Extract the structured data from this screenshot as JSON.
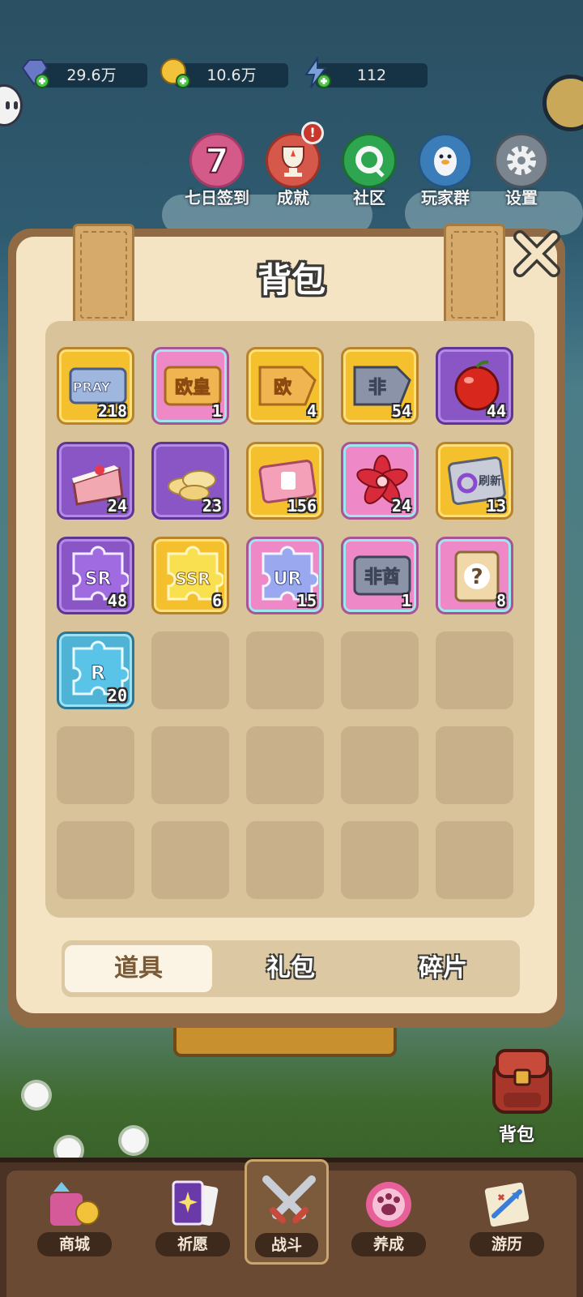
{
  "resources": [
    {
      "icon": "gem-plus-icon",
      "value": "29.6万"
    },
    {
      "icon": "coin-plus-icon",
      "value": "10.6万"
    },
    {
      "icon": "energy-plus-icon",
      "value": "112"
    }
  ],
  "menu": [
    {
      "label": "七日签到",
      "icon": "seven-day-icon",
      "badge": "7"
    },
    {
      "label": "成就",
      "icon": "trophy-icon",
      "alert": "!"
    },
    {
      "label": "社区",
      "icon": "chat-bubble-icon"
    },
    {
      "label": "玩家群",
      "icon": "penguin-icon"
    },
    {
      "label": "设置",
      "icon": "gear-icon"
    }
  ],
  "panel": {
    "title": "背包",
    "items": [
      {
        "name": "pray-ticket",
        "frame": "gold",
        "count": "218",
        "text": "PRAY"
      },
      {
        "name": "ouhuang-ticket",
        "frame": "pink",
        "count": "1",
        "text": "欧皇"
      },
      {
        "name": "ouhuang-fragment",
        "frame": "gold",
        "count": "4",
        "text": "欧"
      },
      {
        "name": "feiqiu-fragment",
        "frame": "gold",
        "count": "54",
        "text": "非"
      },
      {
        "name": "apple",
        "frame": "purple",
        "count": "44"
      },
      {
        "name": "cake",
        "frame": "purple",
        "count": "24"
      },
      {
        "name": "chips",
        "frame": "purple",
        "count": "23"
      },
      {
        "name": "gacha-ticket",
        "frame": "gold",
        "count": "156"
      },
      {
        "name": "flower-token",
        "frame": "pink",
        "count": "24"
      },
      {
        "name": "refresh-card",
        "frame": "gold",
        "count": "13",
        "text": "刷新"
      },
      {
        "name": "sr-puzzle",
        "frame": "purple",
        "count": "48",
        "text": "SR"
      },
      {
        "name": "ssr-puzzle",
        "frame": "gold",
        "count": "6",
        "text": "SSR"
      },
      {
        "name": "ur-puzzle",
        "frame": "pink",
        "count": "15",
        "text": "UR"
      },
      {
        "name": "feiqiu-ticket",
        "frame": "pink",
        "count": "1",
        "text": "非酋"
      },
      {
        "name": "mystery-pack",
        "frame": "pink",
        "count": "8",
        "text": "?"
      },
      {
        "name": "r-puzzle",
        "frame": "blue",
        "count": "20",
        "text": "R"
      }
    ],
    "empty_slots": 14,
    "tabs": [
      "道具",
      "礼包",
      "碎片"
    ],
    "active_tab": "道具"
  },
  "bag_button": {
    "label": "背包"
  },
  "nav": [
    {
      "label": "商城",
      "icon": "shop-icon"
    },
    {
      "label": "祈愿",
      "icon": "wish-cards-icon"
    },
    {
      "label": "战斗",
      "icon": "crossed-swords-icon",
      "active": true
    },
    {
      "label": "养成",
      "icon": "paw-icon"
    },
    {
      "label": "游历",
      "icon": "travel-map-icon"
    }
  ],
  "colors": {
    "panel_bg": "#f4e4c4",
    "gold": "#f4c02e",
    "purple": "#8a56c6",
    "pink": "#ef88c6",
    "blue": "#4fb3d6"
  }
}
